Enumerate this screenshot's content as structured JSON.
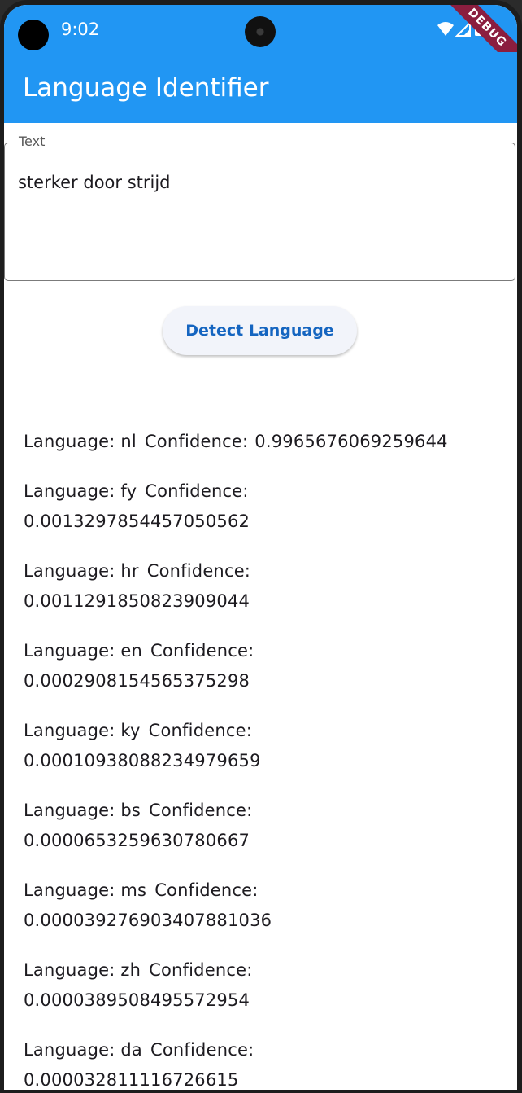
{
  "status_bar": {
    "time": "9:02",
    "debug_label": "DEBUG"
  },
  "app_bar": {
    "title": "Language Identifier"
  },
  "text_field": {
    "label": "Text",
    "value": "sterker door strijd"
  },
  "detect_button": {
    "label": "Detect Language"
  },
  "results": [
    {
      "language_label": "Language: nl",
      "confidence_label": "Confidence:",
      "confidence": "0.9965676069259644"
    },
    {
      "language_label": "Language: fy",
      "confidence_label": "Confidence:",
      "confidence": "0.0013297854457050562"
    },
    {
      "language_label": "Language: hr",
      "confidence_label": "Confidence:",
      "confidence": "0.0011291850823909044"
    },
    {
      "language_label": "Language: en",
      "confidence_label": "Confidence:",
      "confidence": "0.0002908154565375298"
    },
    {
      "language_label": "Language: ky",
      "confidence_label": "Confidence:",
      "confidence": "0.00010938088234979659"
    },
    {
      "language_label": "Language: bs",
      "confidence_label": "Confidence:",
      "confidence": "0.0000653259630780667"
    },
    {
      "language_label": "Language: ms",
      "confidence_label": "Confidence:",
      "confidence": "0.000039276903407881036"
    },
    {
      "language_label": "Language: zh",
      "confidence_label": "Confidence:",
      "confidence": "0.0000389508495572954"
    },
    {
      "language_label": "Language: da",
      "confidence_label": "Confidence:",
      "confidence": "0.000032811116726615"
    }
  ],
  "icons": {
    "wifi": "wifi-icon",
    "signal": "signal-icon",
    "battery": "battery-icon"
  },
  "colors": {
    "primary": "#2196f3",
    "button_text": "#1565c0",
    "debug_ribbon": "#8b1e3f"
  }
}
